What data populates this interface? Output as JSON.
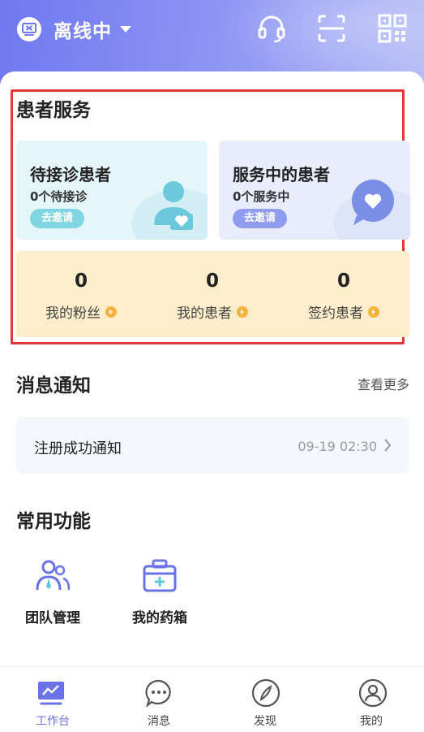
{
  "header": {
    "status_text": "离线中",
    "status_icon": "monitor-icon",
    "icons": [
      "headset-icon",
      "scan-icon",
      "qr-code-icon"
    ]
  },
  "patient_service": {
    "title": "患者服务",
    "waiting": {
      "title": "待接诊患者",
      "sub": "0个待接诊",
      "button": "去邀请"
    },
    "serving": {
      "title": "服务中的患者",
      "sub": "0个服务中",
      "button": "去邀请"
    },
    "stats": [
      {
        "value": "0",
        "label": "我的粉丝"
      },
      {
        "value": "0",
        "label": "我的患者"
      },
      {
        "value": "0",
        "label": "签约患者"
      }
    ]
  },
  "messages": {
    "title": "消息通知",
    "more": "查看更多",
    "items": [
      {
        "text": "注册成功通知",
        "time": "09-19 02:30"
      }
    ]
  },
  "functions": {
    "title": "常用功能",
    "items": [
      {
        "label": "团队管理",
        "icon": "team-icon"
      },
      {
        "label": "我的药箱",
        "icon": "medicine-box-icon"
      }
    ]
  },
  "tabbar": {
    "items": [
      {
        "label": "工作台",
        "icon": "dashboard-icon",
        "active": true
      },
      {
        "label": "消息",
        "icon": "chat-icon",
        "active": false
      },
      {
        "label": "发现",
        "icon": "compass-icon",
        "active": false
      },
      {
        "label": "我的",
        "icon": "user-icon",
        "active": false
      }
    ]
  },
  "colors": {
    "accent": "#6a72e8",
    "header_gradient_start": "#6f78ef",
    "highlight_border": "#e0393a",
    "stats_bg": "#fdeecb"
  }
}
